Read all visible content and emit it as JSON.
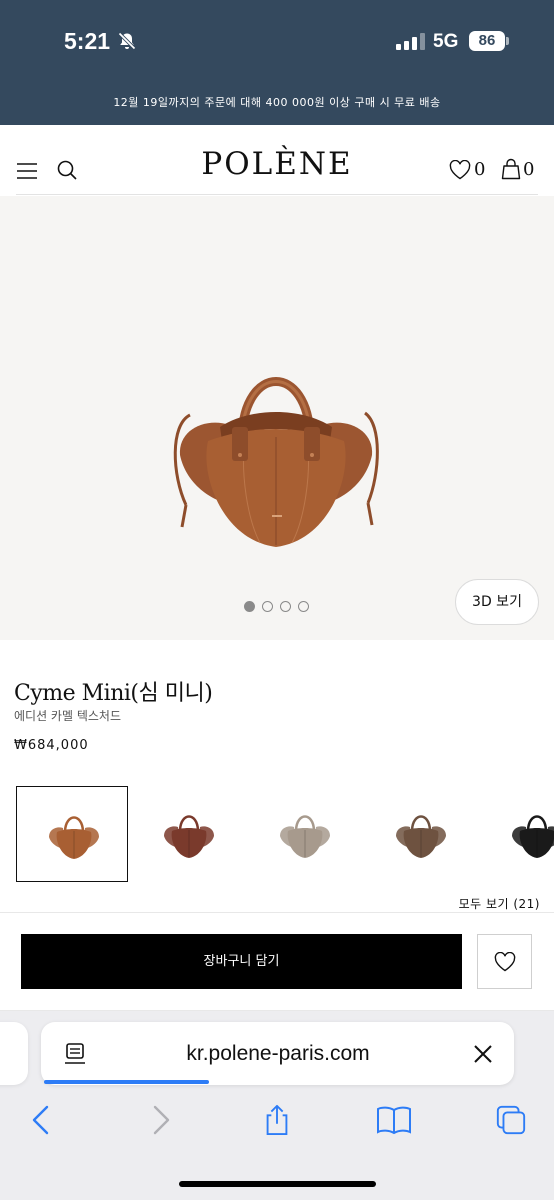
{
  "status_bar": {
    "time": "5:21",
    "network": "5G",
    "battery": "86"
  },
  "promo_banner": {
    "text": "12월 19일까지의 주문에 대해 400 000원 이상 구매 시 무료 배송"
  },
  "header": {
    "logo": "POLÈNE",
    "wishlist_count": "0",
    "bag_count": "0"
  },
  "gallery": {
    "dots_count": 4,
    "active_dot": 0,
    "view_3d_label": "3D 보기"
  },
  "product": {
    "name": "Cyme Mini(심 미니)",
    "variant": "에디션 카멜 텍스처드",
    "price": "₩684,000"
  },
  "swatches": [
    {
      "color": "#a85f33",
      "selected": true
    },
    {
      "color": "#7a3a2c",
      "selected": false
    },
    {
      "color": "#a79a8d",
      "selected": false
    },
    {
      "color": "#6e5240",
      "selected": false
    },
    {
      "color": "#1a1a1a",
      "selected": false
    }
  ],
  "see_all_label": "모두 보기 (21)",
  "add_to_cart_label": "장바구니 담기",
  "browser": {
    "url": "kr.polene-paris.com",
    "load_progress": 0.35
  },
  "colors": {
    "banner_bg": "#34495e",
    "bag_camel": "#a85f33",
    "accent_blue": "#2d7cf6"
  }
}
